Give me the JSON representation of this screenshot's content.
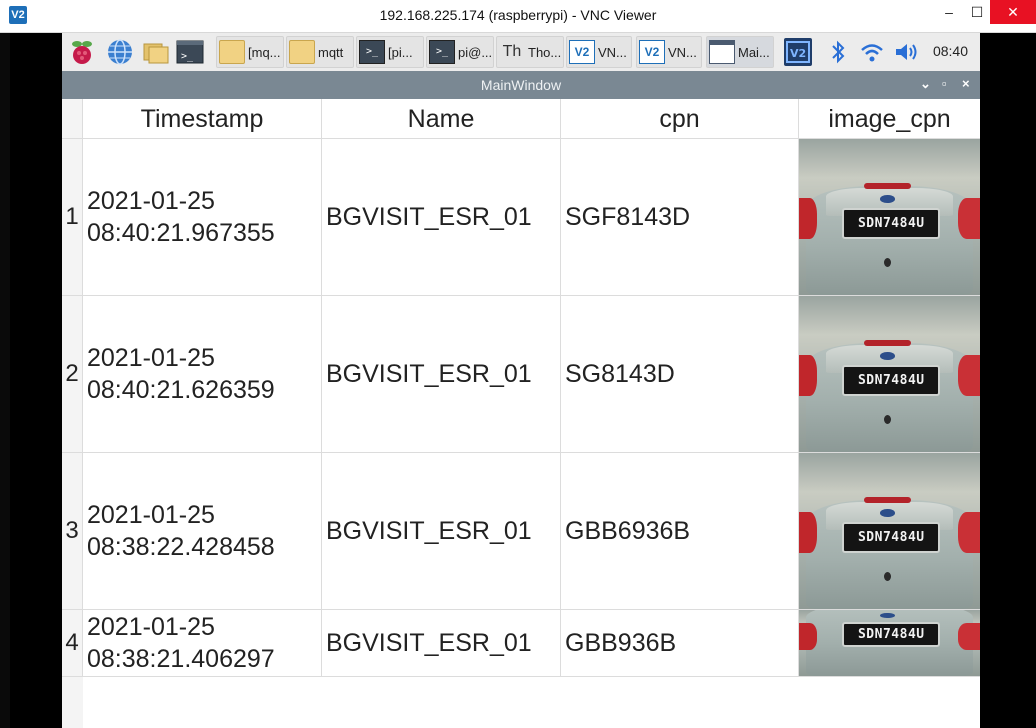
{
  "vnc": {
    "logo": "V2",
    "title": "192.168.225.174 (raspberrypi) - VNC Viewer",
    "minimize": "–",
    "maximize": "☐",
    "close": "✕"
  },
  "taskbar": {
    "launchers": [
      "raspberry-menu-icon",
      "web-browser-icon",
      "file-manager-icon",
      "terminal-icon"
    ],
    "buttons": [
      {
        "label": "[mq...",
        "icon": "folder-icon"
      },
      {
        "label": "mqtt",
        "icon": "folder-icon"
      },
      {
        "label": "[pi...",
        "icon": "terminal-icon"
      },
      {
        "label": "pi@...",
        "icon": "terminal-icon"
      },
      {
        "label": "Tho...",
        "icon": "thonny-icon"
      },
      {
        "label": "VN...",
        "icon": "vnc-icon"
      },
      {
        "label": "VN...",
        "icon": "vnc-icon"
      },
      {
        "label": "Mai...",
        "icon": "window-icon"
      }
    ],
    "tray": [
      "vnc-tray-icon",
      "bluetooth-icon",
      "wifi-icon",
      "volume-icon"
    ],
    "clock": "08:40"
  },
  "app": {
    "title": "MainWindow",
    "controls": {
      "minimize": "⌄",
      "maximize": "▫",
      "close": "×"
    }
  },
  "table": {
    "columns": [
      "Timestamp",
      "Name",
      "cpn",
      "image_cpn"
    ],
    "rows": [
      {
        "index": "1",
        "date": "2021-01-25",
        "time": "08:40:21.967355",
        "name": "BGVISIT_ESR_01",
        "cpn": "SGF8143D",
        "plate": "SDN7484U"
      },
      {
        "index": "2",
        "date": "2021-01-25",
        "time": "08:40:21.626359",
        "name": "BGVISIT_ESR_01",
        "cpn": "SG8143D",
        "plate": "SDN7484U"
      },
      {
        "index": "3",
        "date": "2021-01-25",
        "time": "08:38:22.428458",
        "name": "BGVISIT_ESR_01",
        "cpn": "GBB6936B",
        "plate": "SDN7484U"
      },
      {
        "index": "4",
        "date": "2021-01-25",
        "time": "08:38:21.406297",
        "name": "BGVISIT_ESR_01",
        "cpn": "GBB936B",
        "plate": "SDN7484U"
      }
    ]
  },
  "colors": {
    "titlebar": "#7a8893",
    "taskbar": "#ececec",
    "vnc_close": "#e81123"
  }
}
